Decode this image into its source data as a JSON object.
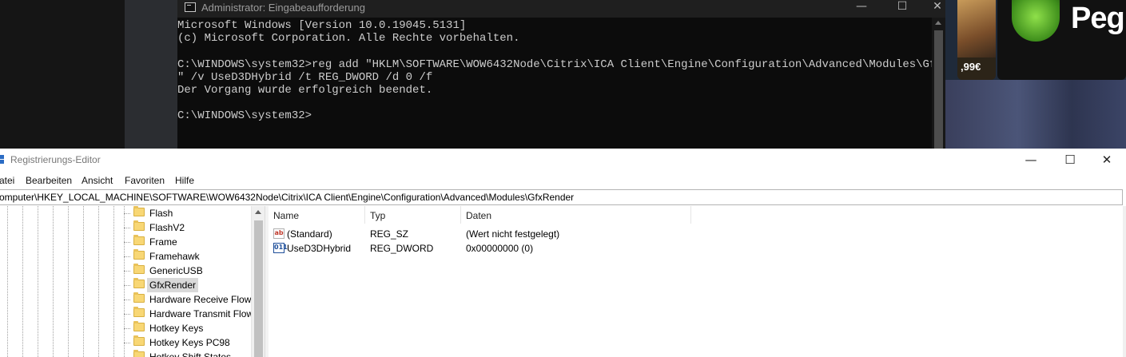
{
  "background": {
    "store_price": ",99€",
    "store_title_fragment": "Peg"
  },
  "console": {
    "title": "Administrator: Eingabeaufforderung",
    "controls": {
      "minimize": "—",
      "maximize": "☐",
      "close": "✕"
    },
    "lines": [
      "Microsoft Windows [Version 10.0.19045.5131]",
      "(c) Microsoft Corporation. Alle Rechte vorbehalten.",
      "",
      "C:\\WINDOWS\\system32>reg add \"HKLM\\SOFTWARE\\WOW6432Node\\Citrix\\ICA Client\\Engine\\Configuration\\Advanced\\Modules\\GfxRender",
      "\" /v UseD3DHybrid /t REG_DWORD /d 0 /f",
      "Der Vorgang wurde erfolgreich beendet.",
      "",
      "C:\\WINDOWS\\system32>"
    ]
  },
  "regedit": {
    "title": "Registrierungs-Editor",
    "controls": {
      "minimize": "—",
      "maximize": "☐",
      "close": "✕"
    },
    "menu": [
      "atei",
      "Bearbeiten",
      "Ansicht",
      "Favoriten",
      "Hilfe"
    ],
    "address": "omputer\\HKEY_LOCAL_MACHINE\\SOFTWARE\\WOW6432Node\\Citrix\\ICA Client\\Engine\\Configuration\\Advanced\\Modules\\GfxRender",
    "tree": [
      {
        "label": "Flash"
      },
      {
        "label": "FlashV2"
      },
      {
        "label": "Frame"
      },
      {
        "label": "Framehawk"
      },
      {
        "label": "GenericUSB"
      },
      {
        "label": "GfxRender",
        "selected": true
      },
      {
        "label": "Hardware Receive Flow"
      },
      {
        "label": "Hardware Transmit Flow"
      },
      {
        "label": "Hotkey Keys"
      },
      {
        "label": "Hotkey Keys PC98"
      },
      {
        "label": "Hotkey Shift States"
      }
    ],
    "columns": {
      "name": "Name",
      "type": "Typ",
      "data": "Daten"
    },
    "values": [
      {
        "icon": "string-value-icon",
        "icon_text": "ab",
        "name": "(Standard)",
        "type": "REG_SZ",
        "data": "(Wert nicht festgelegt)"
      },
      {
        "icon": "binary-value-icon",
        "icon_text": "011",
        "name": "UseD3DHybrid",
        "type": "REG_DWORD",
        "data": "0x00000000 (0)"
      }
    ]
  }
}
